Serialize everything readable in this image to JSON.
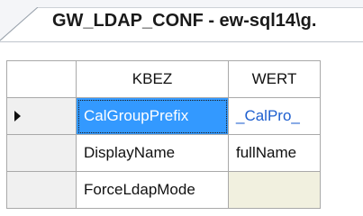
{
  "tab": {
    "title": "GW_LDAP_CONF - ew-sql14\\g."
  },
  "grid": {
    "columns": [
      "KBEZ",
      "WERT"
    ],
    "rows": [
      {
        "kbez": "CalGroupPrefix",
        "wert": "_CalPro_",
        "current": true
      },
      {
        "kbez": "DisplayName",
        "wert": "fullName",
        "current": false
      },
      {
        "kbez": "ForceLdapMode",
        "wert": "",
        "current": false
      }
    ]
  },
  "colors": {
    "selection": "#3399ff",
    "link_text": "#1e5fcf",
    "empty_cell": "#f1f0df",
    "grid_border": "#a9a9a9"
  },
  "icons": {
    "current_row_indicator": "row-pointer-icon"
  }
}
